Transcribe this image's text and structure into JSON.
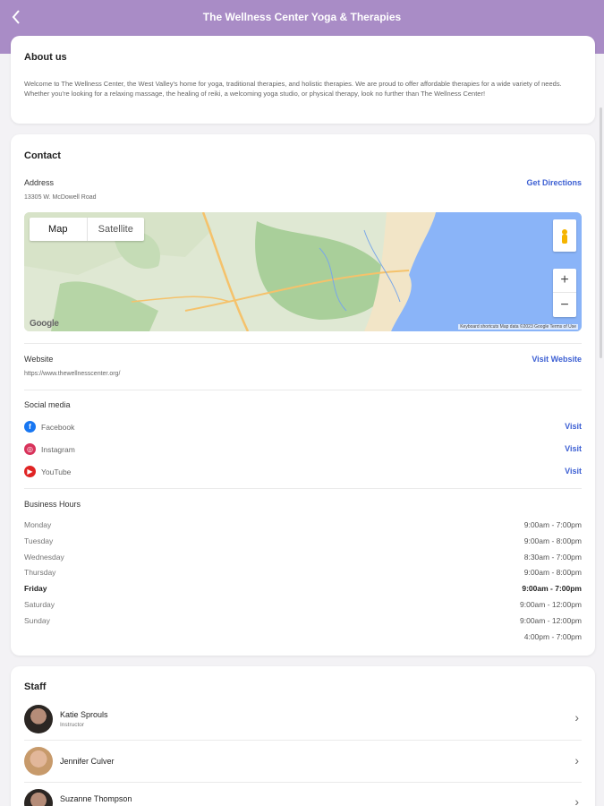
{
  "header": {
    "title": "The Wellness Center Yoga & Therapies",
    "back_icon": "chevron-left-icon"
  },
  "about": {
    "heading": "About us",
    "text": "Welcome to The Wellness Center, the West Valley's home for yoga, traditional therapies, and holistic therapies. We are proud to offer affordable therapies for a wide variety of needs. Whether you're looking for a relaxing massage, the healing of reiki, a welcoming yoga studio, or physical therapy, look no further than The Wellness Center!"
  },
  "contact": {
    "heading": "Contact",
    "address_label": "Address",
    "address": "13305 W. McDowell Road",
    "directions_label": "Get Directions",
    "map": {
      "map_tab": "Map",
      "satellite_tab": "Satellite",
      "zoom_in": "+",
      "zoom_out": "−",
      "logo": "Google",
      "attribution": "Keyboard shortcuts   Map data ©2023 Google   Terms of Use"
    },
    "website_label": "Website",
    "website_url": "https://www.thewellnesscenter.org/",
    "visit_website_label": "Visit Website",
    "social_label": "Social media",
    "social": [
      {
        "name": "Facebook",
        "action": "Visit",
        "icon": "facebook-icon",
        "color": "#1877f2"
      },
      {
        "name": "Instagram",
        "action": "Visit",
        "icon": "instagram-icon",
        "color": "#d8335b"
      },
      {
        "name": "YouTube",
        "action": "Visit",
        "icon": "youtube-icon",
        "color": "#e02424"
      }
    ],
    "hours_label": "Business Hours",
    "hours": [
      {
        "day": "Monday",
        "time": "9:00am - 7:00pm"
      },
      {
        "day": "Tuesday",
        "time": "9:00am - 8:00pm"
      },
      {
        "day": "Wednesday",
        "time": "8:30am - 7:00pm"
      },
      {
        "day": "Thursday",
        "time": "9:00am - 8:00pm"
      },
      {
        "day": "Friday",
        "time": "9:00am - 7:00pm"
      },
      {
        "day": "Saturday",
        "time": "9:00am - 12:00pm"
      },
      {
        "day": "Sunday",
        "time": "9:00am - 12:00pm"
      },
      {
        "day": "",
        "time": "4:00pm - 7:00pm"
      }
    ]
  },
  "staff": {
    "heading": "Staff",
    "members": [
      {
        "name": "Katie Sprouls",
        "role": "Instructor"
      },
      {
        "name": "Jennifer Culver",
        "role": ""
      },
      {
        "name": "Suzanne Thompson",
        "role": ""
      }
    ]
  },
  "colors": {
    "header_bg": "#a98cc6",
    "link": "#3c5fd3"
  }
}
